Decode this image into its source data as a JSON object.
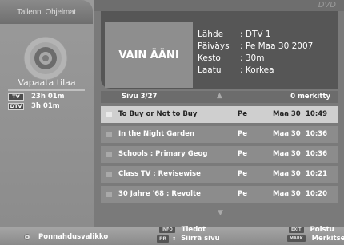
{
  "left": {
    "tab_title": "Tallenn. Ohjelmat",
    "free_space_label": "Vapaata tilaa",
    "rows": [
      {
        "badge": "TV",
        "value": "23h 01m"
      },
      {
        "badge": "DTV",
        "value": "3h 01m"
      }
    ]
  },
  "header": {
    "brand": "DVD"
  },
  "info": {
    "thumbnail_text": "VAIN ÄÄNI",
    "details": [
      {
        "key": "Lähde",
        "value": ": DTV 1"
      },
      {
        "key": "Päiväys",
        "value": ": Pe Maa 30 2007"
      },
      {
        "key": "Kesto",
        "value": ": 30m"
      },
      {
        "key": "Laatu",
        "value": ": Korkea"
      }
    ]
  },
  "list": {
    "page_label": "Sivu  3/27",
    "marked_label": "0 merkitty",
    "up_arrow": "▲",
    "down_arrow": "▼",
    "items": [
      {
        "title": "To Buy or Not to Buy",
        "day": "Pe",
        "date": "Maa 30",
        "time": "10:49",
        "selected": true
      },
      {
        "title": "In the Night Garden",
        "day": "Pe",
        "date": "Maa 30",
        "time": "10:36",
        "selected": false
      },
      {
        "title": "Schools : Primary Geog",
        "day": "Pe",
        "date": "Maa 30",
        "time": "10:36",
        "selected": false
      },
      {
        "title": "Class TV : Revisewise",
        "day": "Pe",
        "date": "Maa 30",
        "time": "10:21",
        "selected": false
      },
      {
        "title": "30 Jahre '68 : Revolte",
        "day": "Pe",
        "date": "Maa 30",
        "time": "10:20",
        "selected": false
      }
    ]
  },
  "footer": {
    "popup_menu": "Ponnahdusvalikko",
    "info_key": "INFO",
    "info_label": "Tiedot",
    "pr_key": "PR",
    "pr_label": "Siirrä sivu",
    "exit_key": "EXIT",
    "exit_label": "Poistu",
    "mark_key": "MARK",
    "mark_label": "Merkitse"
  }
}
